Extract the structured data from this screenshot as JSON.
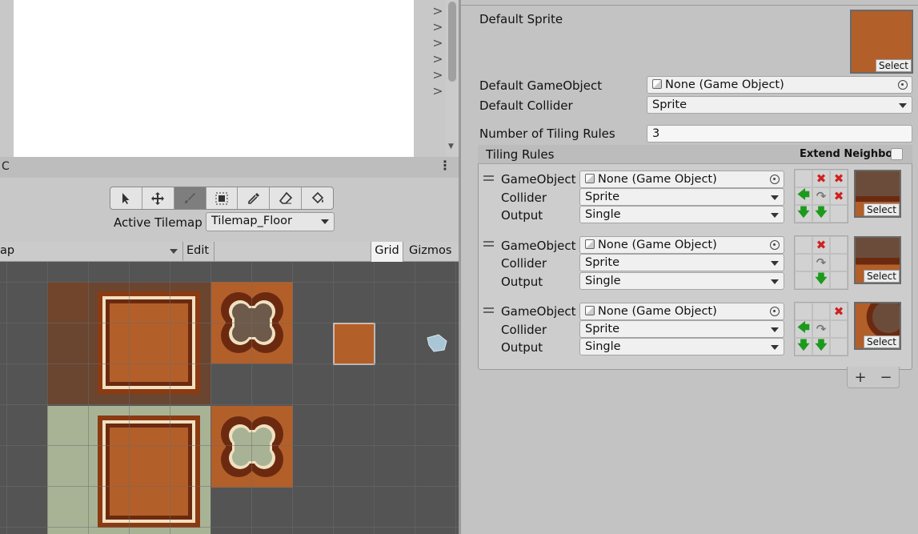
{
  "left_panel": {
    "strip_text": "C",
    "chevrons": [
      ">",
      ">",
      ">",
      ">",
      ">",
      ">"
    ]
  },
  "tile_palette": {
    "tools": [
      "select-tool",
      "move-tool",
      "paint-brush-tool",
      "box-fill-tool",
      "picker-tool",
      "eraser-tool",
      "flood-fill-tool"
    ],
    "active_tool": "paint-brush-tool",
    "active_tilemap_label": "Active Tilemap",
    "active_tilemap_value": "Tilemap_Floor"
  },
  "scene_bar": {
    "palette_name": "ap",
    "edit_label": "Edit",
    "grid_label": "Grid",
    "gizmos_label": "Gizmos"
  },
  "inspector": {
    "default_sprite_label": "Default Sprite",
    "select_label": "Select",
    "default_gameobject_label": "Default GameObject",
    "default_gameobject_value": "None (Game Object)",
    "default_collider_label": "Default Collider",
    "default_collider_value": "Sprite",
    "num_rules_label": "Number of Tiling Rules",
    "num_rules_value": "3",
    "tiling_rules_label": "Tiling Rules",
    "extend_neighbor_label": "Extend Neighbor",
    "rules": [
      {
        "gameobject_label": "GameObject",
        "gameobject_value": "None (Game Object)",
        "collider_label": "Collider",
        "collider_value": "Sprite",
        "output_label": "Output",
        "output_value": "Single",
        "select_label": "Select"
      },
      {
        "gameobject_label": "GameObject",
        "gameobject_value": "None (Game Object)",
        "collider_label": "Collider",
        "collider_value": "Sprite",
        "output_label": "Output",
        "output_value": "Single",
        "select_label": "Select"
      },
      {
        "gameobject_label": "GameObject",
        "gameobject_value": "None (Game Object)",
        "collider_label": "Collider",
        "collider_value": "Sprite",
        "output_label": "Output",
        "output_value": "Single",
        "select_label": "Select"
      }
    ],
    "add_label": "+",
    "remove_label": "−"
  },
  "colors": {
    "tile_orange": "#b35f2a",
    "tile_dark": "#6b2a10",
    "tile_pale": "#a8b396",
    "scene_bg": "#545454"
  }
}
